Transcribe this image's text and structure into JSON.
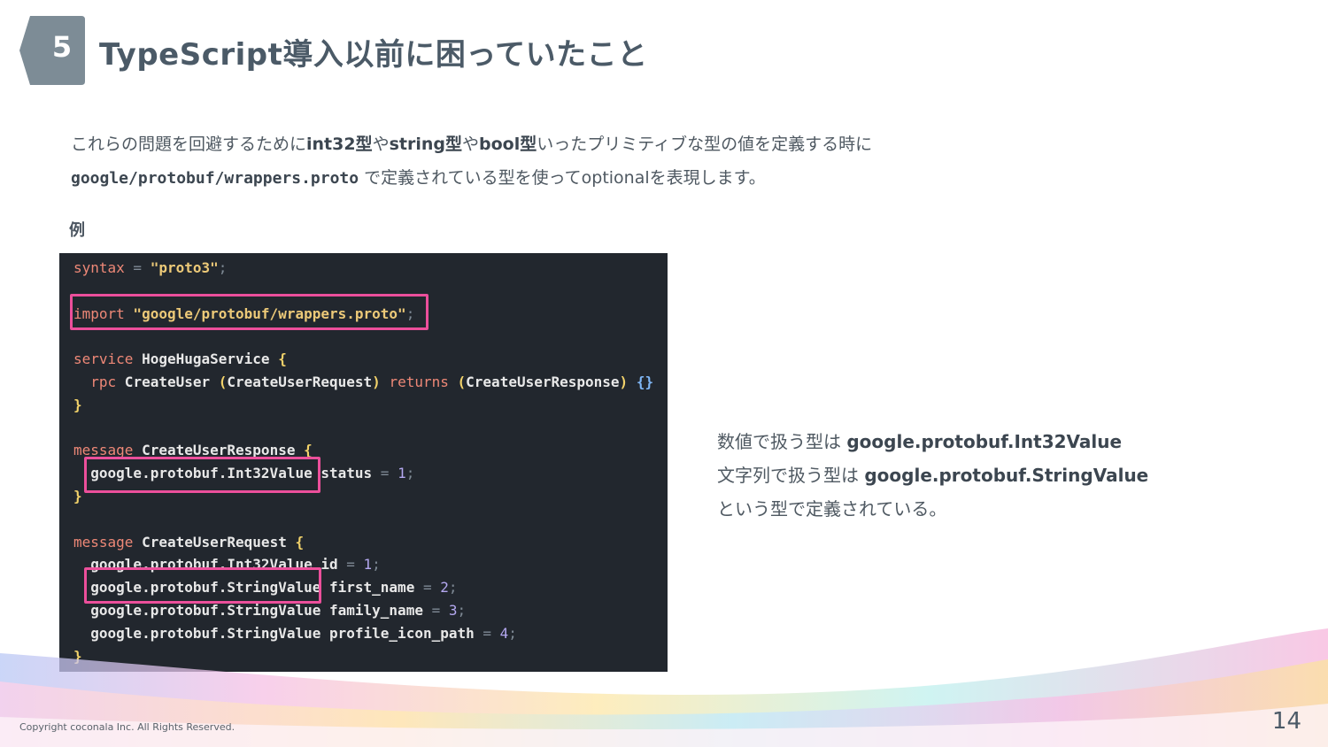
{
  "header": {
    "section_number": "5",
    "title": "TypeScript導入以前に困っていたこと"
  },
  "intro": {
    "line1_part1": "これらの問題を回避するために",
    "line1_type_int": "int32型",
    "line1_sep1": "や",
    "line1_type_string": "string型",
    "line1_sep2": "や",
    "line1_type_bool": "bool型",
    "line1_part2": "いったプリミティブな型の値を定義する時に",
    "line2_path": "google/protobuf/wrappers.proto",
    "line2_rest": " で定義されている型を使ってoptionalを表現します。"
  },
  "example_label": "例",
  "code": {
    "l1_kw": "syntax",
    "l1_eq": " = ",
    "l1_str": "\"proto3\"",
    "l1_end": ";",
    "l3_kw": "import",
    "l3_str": " \"google/protobuf/wrappers.proto\"",
    "l3_end": ";",
    "l5_kw": "service",
    "l5_name": " HogeHugaService ",
    "l5_brace": "{",
    "l6_kw": "  rpc",
    "l6_name": " CreateUser ",
    "l6_p1": "(",
    "l6_req": "CreateUserRequest",
    "l6_p2": ")",
    "l6_kw2": " returns ",
    "l6_p3": "(",
    "l6_res": "CreateUserResponse",
    "l6_p4": ")",
    "l6_braces": " {}",
    "l7_brace": "}",
    "l9_kw": "message",
    "l9_name": " CreateUserResponse ",
    "l9_brace": "{",
    "l10_type": "  google.protobuf.Int32Value",
    "l10_field": " status",
    "l10_eq": " = ",
    "l10_num": "1",
    "l10_end": ";",
    "l11_brace": "}",
    "l13_kw": "message",
    "l13_name": " CreateUserRequest ",
    "l13_brace": "{",
    "l14_type": "  google.protobuf.Int32Value",
    "l14_field": " id",
    "l14_eq": " = ",
    "l14_num": "1",
    "l14_end": ";",
    "l15_type": "  google.protobuf.StringValue",
    "l15_field": " first_name",
    "l15_eq": " = ",
    "l15_num": "2",
    "l15_end": ";",
    "l16_type": "  google.protobuf.StringValue",
    "l16_field": " family_name",
    "l16_eq": " = ",
    "l16_num": "3",
    "l16_end": ";",
    "l17_type": "  google.protobuf.StringValue",
    "l17_field": " profile_icon_path",
    "l17_eq": " = ",
    "l17_num": "4",
    "l17_end": ";",
    "l18_brace": "}"
  },
  "side_note": {
    "line1_text": "数値で扱う型は ",
    "line1_type": "google.protobuf.Int32Value",
    "line2_text": "文字列で扱う型は ",
    "line2_type": "google.protobuf.StringValue",
    "line3_text": "という型で定義されている。"
  },
  "footer": {
    "copyright": "Copyright coconala Inc. All Rights Reserved.",
    "page_number": "14"
  },
  "colors": {
    "accent_pink": "#ec4f9b",
    "badge_gray": "#7d8c96",
    "code_bg": "#22272e"
  }
}
